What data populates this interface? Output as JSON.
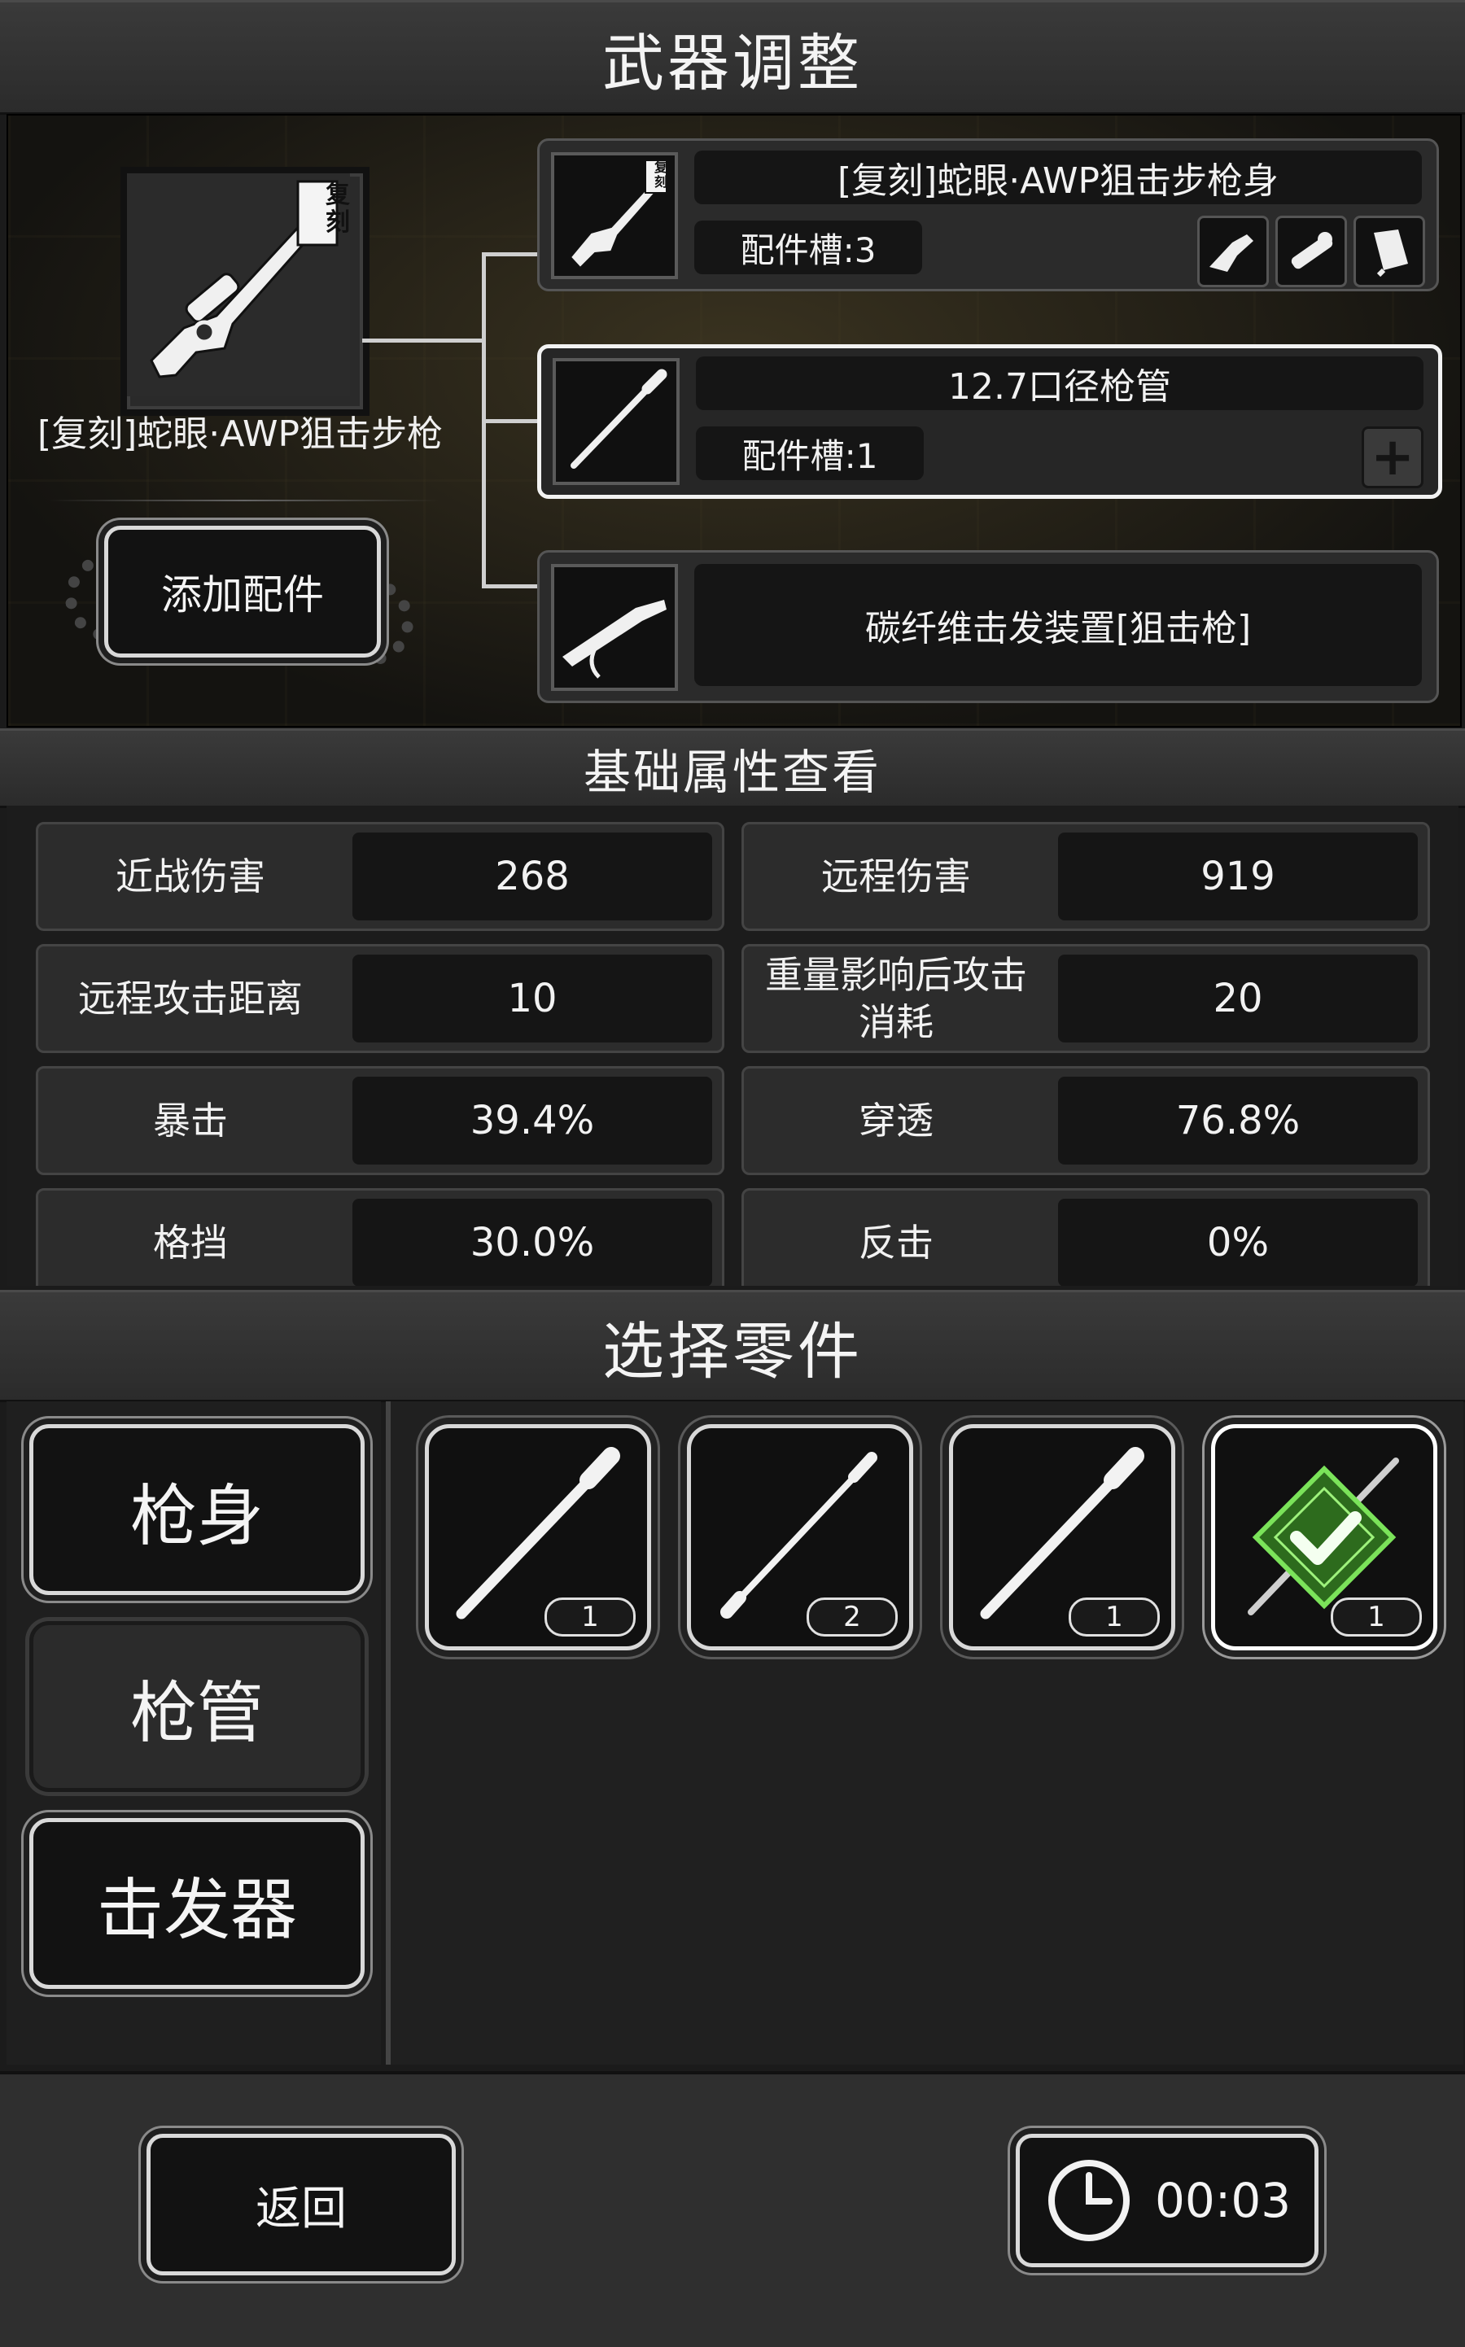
{
  "title": "武器调整",
  "main_weapon": {
    "name": "[复刻]蛇眼·AWP狙击步枪",
    "badge": "复刻",
    "add_button": "添加配件"
  },
  "slots": [
    {
      "name": "[复刻]蛇眼·AWP狙击步枪身",
      "sub": "配件槽:3",
      "badge": "复刻",
      "mini_icons": [
        "gun-part-icon",
        "scope-icon",
        "magazine-icon"
      ],
      "selected": false
    },
    {
      "name": "12.7口径枪管",
      "sub": "配件槽:1",
      "plus_icon": "plus-icon",
      "selected": true
    },
    {
      "name": "碳纤维击发装置[狙击枪]",
      "selected": false
    }
  ],
  "attributes_title": "基础属性查看",
  "stats": [
    {
      "label": "近战伤害",
      "value": "268"
    },
    {
      "label": "远程伤害",
      "value": "919"
    },
    {
      "label": "远程攻击距离",
      "value": "10"
    },
    {
      "label": "重量影响后攻击消耗",
      "value": "20"
    },
    {
      "label": "暴击",
      "value": "39.4%"
    },
    {
      "label": "穿透",
      "value": "76.8%"
    },
    {
      "label": "格挡",
      "value": "30.0%"
    },
    {
      "label": "反击",
      "value": "0%"
    }
  ],
  "parts_title": "选择零件",
  "categories": [
    {
      "label": "枪身",
      "active": false
    },
    {
      "label": "枪管",
      "active": true
    },
    {
      "label": "击发器",
      "active": false
    }
  ],
  "parts": [
    {
      "count": "1",
      "equipped": false
    },
    {
      "count": "2",
      "equipped": false
    },
    {
      "count": "1",
      "equipped": false
    },
    {
      "count": "1",
      "equipped": true
    }
  ],
  "footer": {
    "back": "返回",
    "timer": "00:03"
  },
  "colors": {
    "equipped_green": "#6bd64a",
    "panel_border": "#d9d9d9"
  }
}
